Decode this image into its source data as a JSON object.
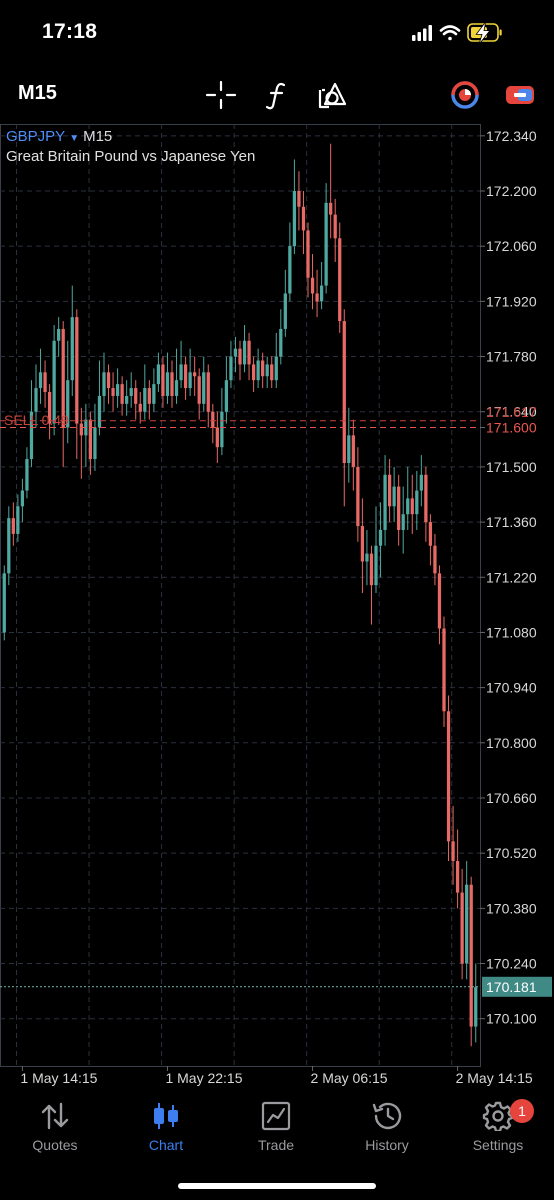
{
  "status": {
    "time": "17:18"
  },
  "toolbar": {
    "timeframe": "M15",
    "icons": [
      "crosshair-icon",
      "function-icon",
      "objects-icon",
      "clock-icon",
      "connect-icon"
    ]
  },
  "chart": {
    "symbol": "GBPJPY",
    "timeframe": "M15",
    "description": "Great Britain Pound vs Japanese Yen",
    "order_line_label": "SELL 0.49",
    "order_price_tag": "171.617",
    "bid_line_price": "171.600",
    "current_price": "170.181",
    "colors": {
      "bull": "#4fa9a0",
      "bear": "#e86a66",
      "grid": "#2c3140",
      "symbol": "#4f8ef7",
      "order": "#c9443c"
    }
  },
  "chart_data": {
    "type": "candlestick",
    "y_ticks": [
      "172.340",
      "172.200",
      "172.060",
      "171.920",
      "171.780",
      "171.640",
      "171.600",
      "171.500",
      "171.360",
      "171.220",
      "171.080",
      "170.940",
      "170.800",
      "170.660",
      "170.520",
      "170.380",
      "170.240",
      "170.100"
    ],
    "x_ticks": [
      "1 May 14:15",
      "1 May 22:15",
      "2 May 06:15",
      "2 May 14:15"
    ],
    "ylim": [
      169.98,
      172.37
    ],
    "candles": [
      [
        171.08,
        171.23,
        171.06,
        171.25
      ],
      [
        171.23,
        171.37,
        171.2,
        171.4
      ],
      [
        171.37,
        171.33,
        171.3,
        171.41
      ],
      [
        171.33,
        171.4,
        171.31,
        171.43
      ],
      [
        171.4,
        171.44,
        171.36,
        171.47
      ],
      [
        171.44,
        171.52,
        171.42,
        171.55
      ],
      [
        171.52,
        171.64,
        171.5,
        171.72
      ],
      [
        171.64,
        171.7,
        171.6,
        171.76
      ],
      [
        171.7,
        171.74,
        171.66,
        171.8
      ],
      [
        171.74,
        171.69,
        171.65,
        171.77
      ],
      [
        171.69,
        171.61,
        171.57,
        171.71
      ],
      [
        171.61,
        171.82,
        171.58,
        171.86
      ],
      [
        171.82,
        171.85,
        171.78,
        171.88
      ],
      [
        171.85,
        171.6,
        171.5,
        171.87
      ],
      [
        171.6,
        171.72,
        171.56,
        171.82
      ],
      [
        171.72,
        171.88,
        171.68,
        171.96
      ],
      [
        171.88,
        171.61,
        171.52,
        171.9
      ],
      [
        171.61,
        171.58,
        171.47,
        171.65
      ],
      [
        171.58,
        171.62,
        171.5,
        171.66
      ],
      [
        171.62,
        171.52,
        171.48,
        171.64
      ],
      [
        171.52,
        171.6,
        171.49,
        171.66
      ],
      [
        171.6,
        171.68,
        171.58,
        171.77
      ],
      [
        171.68,
        171.74,
        171.64,
        171.79
      ],
      [
        171.74,
        171.7,
        171.66,
        171.76
      ],
      [
        171.7,
        171.68,
        171.64,
        171.74
      ],
      [
        171.68,
        171.71,
        171.65,
        171.75
      ],
      [
        171.71,
        171.66,
        171.63,
        171.73
      ],
      [
        171.66,
        171.68,
        171.63,
        171.72
      ],
      [
        171.68,
        171.7,
        171.65,
        171.74
      ],
      [
        171.7,
        171.66,
        171.62,
        171.72
      ],
      [
        171.66,
        171.64,
        171.61,
        171.69
      ],
      [
        171.64,
        171.7,
        171.62,
        171.76
      ],
      [
        171.7,
        171.66,
        171.62,
        171.72
      ],
      [
        171.66,
        171.71,
        171.64,
        171.75
      ],
      [
        171.71,
        171.76,
        171.69,
        171.79
      ],
      [
        171.76,
        171.68,
        171.65,
        171.78
      ],
      [
        171.68,
        171.74,
        171.66,
        171.79
      ],
      [
        171.74,
        171.68,
        171.65,
        171.77
      ],
      [
        171.68,
        171.72,
        171.66,
        171.8
      ],
      [
        171.72,
        171.76,
        171.7,
        171.82
      ],
      [
        171.76,
        171.7,
        171.67,
        171.78
      ],
      [
        171.7,
        171.74,
        171.68,
        171.8
      ],
      [
        171.74,
        171.73,
        171.68,
        171.78
      ],
      [
        171.73,
        171.66,
        171.62,
        171.75
      ],
      [
        171.66,
        171.74,
        171.64,
        171.78
      ],
      [
        171.74,
        171.64,
        171.6,
        171.76
      ],
      [
        171.64,
        171.6,
        171.56,
        171.66
      ],
      [
        171.6,
        171.55,
        171.51,
        171.64
      ],
      [
        171.55,
        171.64,
        171.53,
        171.7
      ],
      [
        171.64,
        171.72,
        171.61,
        171.78
      ],
      [
        171.72,
        171.78,
        171.7,
        171.82
      ],
      [
        171.78,
        171.8,
        171.74,
        171.83
      ],
      [
        171.8,
        171.76,
        171.72,
        171.82
      ],
      [
        171.76,
        171.82,
        171.74,
        171.86
      ],
      [
        171.82,
        171.76,
        171.72,
        171.84
      ],
      [
        171.76,
        171.72,
        171.69,
        171.78
      ],
      [
        171.72,
        171.77,
        171.7,
        171.8
      ],
      [
        171.77,
        171.73,
        171.7,
        171.79
      ],
      [
        171.73,
        171.76,
        171.7,
        171.78
      ],
      [
        171.76,
        171.72,
        171.7,
        171.78
      ],
      [
        171.72,
        171.78,
        171.7,
        171.84
      ],
      [
        171.78,
        171.85,
        171.76,
        171.9
      ],
      [
        171.85,
        171.94,
        171.83,
        172.0
      ],
      [
        171.94,
        172.06,
        171.92,
        172.12
      ],
      [
        172.06,
        172.2,
        172.04,
        172.28
      ],
      [
        172.2,
        172.16,
        172.1,
        172.25
      ],
      [
        172.16,
        172.1,
        172.04,
        172.2
      ],
      [
        172.1,
        171.98,
        171.93,
        172.12
      ],
      [
        171.98,
        171.94,
        171.9,
        172.04
      ],
      [
        171.94,
        171.92,
        171.88,
        172.0
      ],
      [
        171.92,
        171.96,
        171.9,
        172.02
      ],
      [
        171.96,
        172.17,
        171.94,
        172.22
      ],
      [
        172.17,
        172.14,
        172.08,
        172.32
      ],
      [
        172.14,
        172.08,
        172.02,
        172.18
      ],
      [
        172.08,
        171.87,
        171.84,
        172.12
      ],
      [
        171.87,
        171.51,
        171.4,
        171.9
      ],
      [
        171.51,
        171.58,
        171.46,
        171.65
      ],
      [
        171.58,
        171.5,
        171.44,
        171.62
      ],
      [
        171.5,
        171.35,
        171.31,
        171.55
      ],
      [
        171.35,
        171.26,
        171.18,
        171.42
      ],
      [
        171.26,
        171.28,
        171.2,
        171.34
      ],
      [
        171.28,
        171.2,
        171.1,
        171.3
      ],
      [
        171.2,
        171.3,
        171.18,
        171.4
      ],
      [
        171.3,
        171.34,
        171.22,
        171.41
      ],
      [
        171.34,
        171.48,
        171.3,
        171.53
      ],
      [
        171.48,
        171.4,
        171.36,
        171.52
      ],
      [
        171.4,
        171.45,
        171.36,
        171.5
      ],
      [
        171.45,
        171.34,
        171.3,
        171.48
      ],
      [
        171.34,
        171.38,
        171.28,
        171.45
      ],
      [
        171.38,
        171.42,
        171.34,
        171.5
      ],
      [
        171.42,
        171.38,
        171.33,
        171.48
      ],
      [
        171.38,
        171.44,
        171.34,
        171.49
      ],
      [
        171.44,
        171.48,
        171.4,
        171.53
      ],
      [
        171.48,
        171.36,
        171.31,
        171.5
      ],
      [
        171.36,
        171.3,
        171.25,
        171.38
      ],
      [
        171.3,
        171.23,
        171.2,
        171.33
      ],
      [
        171.23,
        171.09,
        171.05,
        171.25
      ],
      [
        171.09,
        170.88,
        170.84,
        171.12
      ],
      [
        170.88,
        170.55,
        170.5,
        170.92
      ],
      [
        170.55,
        170.5,
        170.44,
        170.64
      ],
      [
        170.5,
        170.42,
        170.38,
        170.58
      ],
      [
        170.42,
        170.24,
        170.2,
        170.48
      ],
      [
        170.24,
        170.44,
        170.2,
        170.5
      ],
      [
        170.44,
        170.08,
        170.03,
        170.46
      ],
      [
        170.08,
        170.18,
        170.04,
        170.24
      ]
    ]
  },
  "nav": [
    {
      "label": "Quotes"
    },
    {
      "label": "Chart"
    },
    {
      "label": "Trade"
    },
    {
      "label": "History"
    },
    {
      "label": "Settings",
      "badge": "1"
    }
  ]
}
